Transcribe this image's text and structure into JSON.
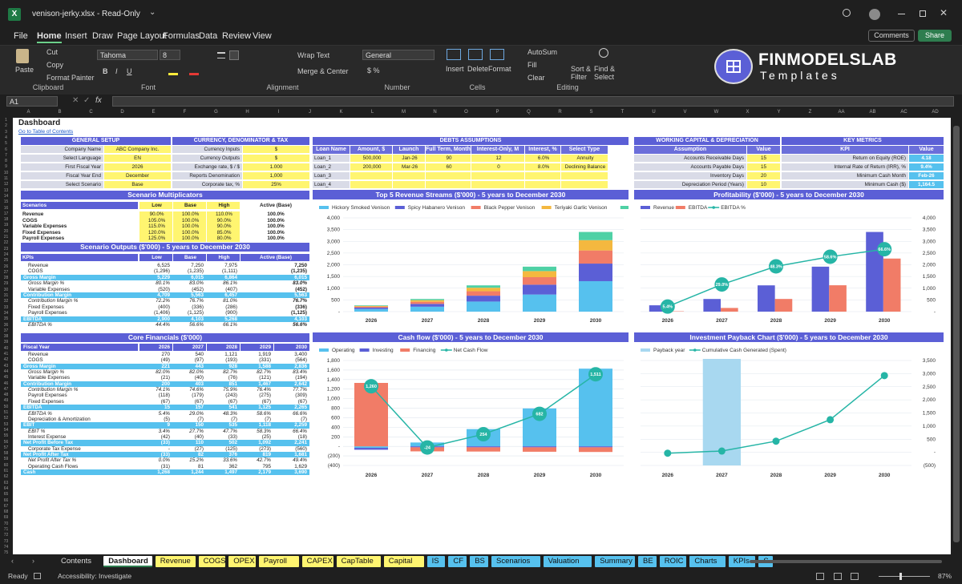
{
  "window": {
    "file_title": "venison-jerky.xlsx - Read-Only",
    "chevron": "⌄"
  },
  "menu": {
    "items": [
      "File",
      "Home",
      "Insert",
      "Draw",
      "Page Layout",
      "Formulas",
      "Data",
      "Review",
      "View"
    ],
    "active": "Home",
    "comments": "Comments",
    "share": "Share"
  },
  "ribbon": {
    "clipboard": {
      "paste": "Paste",
      "cut": "Cut",
      "copy": "Copy",
      "format_painter": "Format Painter",
      "group": "Clipboard"
    },
    "font": {
      "name": "Tahoma",
      "size": "8",
      "group": "Font"
    },
    "alignment": {
      "wrap": "Wrap Text",
      "merge": "Merge & Center",
      "group": "Alignment"
    },
    "number": {
      "format": "General",
      "group": "Number"
    },
    "cells": {
      "insert": "Insert",
      "delete": "Delete",
      "format": "Format",
      "group": "Cells"
    },
    "editing": {
      "autosum": "AutoSum",
      "fill": "Fill",
      "clear": "Clear",
      "sort": "Sort & Filter",
      "find": "Find & Select",
      "group": "Editing"
    },
    "logo": {
      "line1": "FINMODELSLAB",
      "line2": "Templates"
    }
  },
  "formula_bar": {
    "cell_ref": "A1",
    "fx": "fx",
    "value": ""
  },
  "columns": [
    "A",
    "B",
    "C",
    "D",
    "E",
    "F",
    "G",
    "H",
    "I",
    "J",
    "K",
    "L",
    "M",
    "N",
    "O",
    "P",
    "Q",
    "R",
    "S",
    "T",
    "U",
    "V",
    "W",
    "X",
    "Y",
    "Z",
    "AA",
    "AB",
    "AC",
    "AD"
  ],
  "rows": [
    "1",
    "2",
    "3",
    "4",
    "5",
    "6",
    "7",
    "8",
    "9",
    "10",
    "11",
    "12",
    "13",
    "14",
    "15",
    "16",
    "17",
    "18",
    "19",
    "20",
    "21",
    "22",
    "23",
    "24",
    "25",
    "26",
    "27",
    "28",
    "29",
    "30",
    "31",
    "32",
    "33",
    "34",
    "35",
    "36",
    "37",
    "38",
    "39",
    "40",
    "41",
    "42",
    "43",
    "44",
    "45",
    "46",
    "47",
    "48",
    "49",
    "50",
    "51",
    "52",
    "53",
    "54",
    "55",
    "56",
    "57",
    "58",
    "59",
    "60",
    "61",
    "62",
    "63",
    "64",
    "65",
    "66",
    "67",
    "68",
    "69",
    "70",
    "71",
    "72",
    "73",
    "74",
    "75"
  ],
  "sheet": {
    "title": "Dashboard",
    "toc_link": "Go to Table of Contents",
    "general_setup": {
      "header": "GENERAL SETUP",
      "rows": [
        [
          "Company Name",
          "ABC Company Inc."
        ],
        [
          "Select Language",
          "EN"
        ],
        [
          "First Fiscal Year",
          "2026"
        ],
        [
          "Fiscal Year End",
          "December"
        ],
        [
          "Select Scenario",
          "Base"
        ]
      ]
    },
    "currency": {
      "header": "CURRENCY, DENOMINATOR & TAX",
      "rows": [
        [
          "Currency Inputs",
          "$"
        ],
        [
          "Currency Outputs",
          "$"
        ],
        [
          "Exchange rate, $ / $",
          "1.000"
        ],
        [
          "Reports Denomination",
          "1,000"
        ],
        [
          "Corporate tax, %",
          "25%"
        ]
      ]
    },
    "debts": {
      "header": "DEBTS ASSUMPTIONS",
      "cols": [
        "Loan Name",
        "Amount, $",
        "Launch",
        "Full Term, Months",
        "Interest-Only, M",
        "Interest, %",
        "Select Type"
      ],
      "rows": [
        [
          "Loan_1",
          "500,000",
          "Jan-26",
          "90",
          "12",
          "6.0%",
          "Annuity"
        ],
        [
          "Loan_2",
          "200,000",
          "Mar-26",
          "60",
          "0",
          "8.0%",
          "Declining Balance"
        ],
        [
          "Loan_3",
          "",
          "",
          "",
          "",
          "",
          ""
        ],
        [
          "Loan_4",
          "",
          "",
          "",
          "",
          "",
          ""
        ]
      ]
    },
    "working_capital": {
      "header": "WORKING CAPITAL & DEPRECIATION",
      "cols": [
        "Assumption",
        "Value"
      ],
      "rows": [
        [
          "Accounts Receivable Days",
          "15"
        ],
        [
          "Accounts Payable Days",
          "15"
        ],
        [
          "Inventory Days",
          "20"
        ],
        [
          "Depreciation Period (Years)",
          "10"
        ]
      ]
    },
    "kpis": {
      "header": "KEY METRICS",
      "cols": [
        "KPI",
        "Value"
      ],
      "rows": [
        [
          "Return on Equity (ROE)",
          "4.18"
        ],
        [
          "Internal Rate of Return (IRR), %",
          "9.4%"
        ],
        [
          "Minimum Cash Month",
          "Feb-26"
        ],
        [
          "Minimum Cash ($)",
          "1,164.5"
        ]
      ]
    },
    "scenario_mult": {
      "header": "Scenario Multiplicators",
      "cols": [
        "Scenarios",
        "Low",
        "Base",
        "High",
        "Active (Base)"
      ],
      "rows": [
        [
          "Revenue",
          "90.0%",
          "100.0%",
          "110.0%",
          "100.0%"
        ],
        [
          "COGS",
          "105.0%",
          "100.0%",
          "90.0%",
          "100.0%"
        ],
        [
          "Variable Expenses",
          "115.0%",
          "100.0%",
          "90.0%",
          "100.0%"
        ],
        [
          "Fixed Expenses",
          "120.0%",
          "100.0%",
          "85.0%",
          "100.0%"
        ],
        [
          "Payroll Expenses",
          "125.0%",
          "100.0%",
          "80.0%",
          "100.0%"
        ]
      ]
    },
    "scenario_out": {
      "header": "Scenario Outputs ($'000) - 5 years to December 2030",
      "cols": [
        "KPIs",
        "Low",
        "Base",
        "High",
        "Active (Base)"
      ],
      "rows": [
        [
          "Revenue",
          "6,525",
          "7,250",
          "7,975",
          "7,250",
          "n"
        ],
        [
          "COGS",
          "(1,296)",
          "(1,235)",
          "(1,111)",
          "(1,235)",
          "n"
        ],
        [
          "Gross Margin",
          "5,229",
          "6,015",
          "6,864",
          "6,015",
          "h"
        ],
        [
          "Gross Margin %",
          "80.1%",
          "83.0%",
          "86.1%",
          "83.0%",
          "i"
        ],
        [
          "Variable Expenses",
          "(520)",
          "(452)",
          "(407)",
          "(452)",
          "n"
        ],
        [
          "Contribution Margin",
          "4,709",
          "5,563",
          "6,457",
          "5,563",
          "h"
        ],
        [
          "Contribution Margin %",
          "72.2%",
          "76.7%",
          "81.0%",
          "76.7%",
          "i"
        ],
        [
          "Fixed Expenses",
          "(400)",
          "(336)",
          "(286)",
          "(336)",
          "n"
        ],
        [
          "Payroll Expenses",
          "(1,406)",
          "(1,125)",
          "(900)",
          "(1,125)",
          "n"
        ],
        [
          "EBITDA",
          "2,900",
          "4,103",
          "5,268",
          "4,103",
          "h"
        ],
        [
          "EBITDA %",
          "44.4%",
          "56.6%",
          "66.1%",
          "56.6%",
          "i"
        ]
      ]
    },
    "core": {
      "header": "Core Financials ($'000)",
      "cols": [
        "Fiscal Year",
        "2026",
        "2027",
        "2028",
        "2029",
        "2030"
      ],
      "rows": [
        [
          "Revenue",
          "270",
          "540",
          "1,121",
          "1,919",
          "3,400",
          "n"
        ],
        [
          "COGS",
          "(49)",
          "(97)",
          "(193)",
          "(331)",
          "(564)",
          "n"
        ],
        [
          "Gross Margin",
          "221",
          "443",
          "928",
          "1,588",
          "2,836",
          "h"
        ],
        [
          "Gross Margin %",
          "82.0%",
          "82.0%",
          "82.7%",
          "82.7%",
          "83.4%",
          "i"
        ],
        [
          "Variable Expenses",
          "(21)",
          "(40)",
          "(76)",
          "(121)",
          "(194)",
          "n"
        ],
        [
          "Contribution Margin",
          "200",
          "403",
          "851",
          "1,467",
          "2,642",
          "h"
        ],
        [
          "Contribution Margin %",
          "74.1%",
          "74.6%",
          "75.9%",
          "76.4%",
          "77.7%",
          "i"
        ],
        [
          "Payroll Expenses",
          "(118)",
          "(179)",
          "(243)",
          "(275)",
          "(309)",
          "n"
        ],
        [
          "Fixed Expenses",
          "(67)",
          "(67)",
          "(67)",
          "(67)",
          "(67)",
          "n"
        ],
        [
          "EBITDA",
          "15",
          "157",
          "541",
          "1,125",
          "2,265",
          "h"
        ],
        [
          "EBITDA %",
          "5.4%",
          "29.0%",
          "48.3%",
          "58.6%",
          "66.6%",
          "i"
        ],
        [
          "Depreciation & Amortization",
          "(5)",
          "(7)",
          "(7)",
          "(7)",
          "(7)",
          "n"
        ],
        [
          "EBIT",
          "9",
          "150",
          "535",
          "1,118",
          "2,259",
          "h"
        ],
        [
          "EBIT %",
          "3.4%",
          "27.7%",
          "47.7%",
          "58.3%",
          "66.4%",
          "i"
        ],
        [
          "Interest Expense",
          "(42)",
          "(40)",
          "(33)",
          "(25)",
          "(18)",
          "n"
        ],
        [
          "Net Profit Before Tax",
          "(33)",
          "110",
          "502",
          "1,092",
          "2,241",
          "h"
        ],
        [
          "Corporate Tax Expense",
          "-",
          "(27)",
          "(125)",
          "(273)",
          "(560)",
          "n"
        ],
        [
          "Net Profit After Tax",
          "(33)",
          "82",
          "376",
          "819",
          "1,681",
          "h"
        ],
        [
          "Net Profit After Tax %",
          "0.0%",
          "15.2%",
          "33.6%",
          "42.7%",
          "49.4%",
          "i"
        ],
        [
          "Operating Cash Flows",
          "(31)",
          "81",
          "362",
          "795",
          "1,629",
          "n"
        ],
        [
          "Cash",
          "1,268",
          "1,244",
          "1,497",
          "2,179",
          "3,690",
          "h"
        ]
      ]
    }
  },
  "chart_data": [
    {
      "type": "bar",
      "title": "Top 5 Revenue Streams ($'000) - 5 years to December 2030",
      "categories": [
        "2026",
        "2027",
        "2028",
        "2029",
        "2030"
      ],
      "stacked": true,
      "ylim": [
        0,
        4000
      ],
      "yticks": [
        "4,000",
        "3,500",
        "3,000",
        "2,500",
        "2,000",
        "1,500",
        "1,000",
        "500",
        "-"
      ],
      "series": [
        {
          "name": "Hickory Smoked Venison",
          "color": "#56c1ee",
          "values": [
            110,
            210,
            430,
            730,
            1300
          ]
        },
        {
          "name": "Spicy Habanero Venison",
          "color": "#5b5fd6",
          "values": [
            60,
            120,
            250,
            420,
            750
          ]
        },
        {
          "name": "Black Pepper Venison",
          "color": "#f17c67",
          "values": [
            45,
            90,
            190,
            320,
            560
          ]
        },
        {
          "name": "Teriyaki Garlic Venison",
          "color": "#f4b83f",
          "values": [
            30,
            70,
            150,
            260,
            440
          ]
        },
        {
          "name": "Other Revenue",
          "color": "#4fd1a5",
          "values": [
            25,
            50,
            101,
            189,
            350
          ]
        }
      ]
    },
    {
      "type": "bar",
      "title": "Profitability ($'000) - 5 years to December 2030",
      "categories": [
        "2026",
        "2027",
        "2028",
        "2029",
        "2030"
      ],
      "ylim": [
        0,
        4000
      ],
      "yticks": [
        "4,000",
        "3,500",
        "3,000",
        "2,500",
        "2,000",
        "1,500",
        "1,000",
        "500",
        "-"
      ],
      "y2ticks": [
        "100.0%",
        "80.0%",
        "60.0%",
        "40.0%",
        "20.0%",
        "0.0%"
      ],
      "series": [
        {
          "name": "Revenue",
          "color": "#5b5fd6",
          "values": [
            270,
            540,
            1121,
            1919,
            3400
          ]
        },
        {
          "name": "EBITDA",
          "color": "#f17c67",
          "values": [
            15,
            157,
            541,
            1125,
            2265
          ]
        },
        {
          "name": "EBITDA %",
          "color": "#26b5a6",
          "line": true,
          "values": [
            5.4,
            29.0,
            48.3,
            58.6,
            66.6
          ],
          "labels": [
            "5.4%",
            "29.0%",
            "48.3%",
            "58.6%",
            "66.6%"
          ]
        }
      ]
    },
    {
      "type": "bar",
      "title": "Cash flow ($'000) - 5 years to December 2030",
      "categories": [
        "2026",
        "2027",
        "2028",
        "2029",
        "2030"
      ],
      "stacked": true,
      "ylim": [
        -400,
        1800
      ],
      "yticks": [
        "1,800",
        "1,600",
        "1,400",
        "1,200",
        "1,000",
        "800",
        "600",
        "400",
        "200",
        "-",
        "(200)",
        "(400)"
      ],
      "series": [
        {
          "name": "Operating",
          "color": "#56c1ee",
          "values": [
            -31,
            81,
            362,
            795,
            1629
          ]
        },
        {
          "name": "Investing",
          "color": "#5b5fd6",
          "values": [
            -40,
            -20,
            -20,
            -20,
            -20
          ]
        },
        {
          "name": "Financing",
          "color": "#f17c67",
          "values": [
            1330,
            -85,
            -89,
            -93,
            -98
          ]
        },
        {
          "name": "Net Cash Flow",
          "color": "#26b5a6",
          "line": true,
          "values": [
            1260,
            -24,
            254,
            682,
            1511
          ],
          "labels": [
            "1,260",
            "-24",
            "254",
            "682",
            "1,511"
          ]
        }
      ]
    },
    {
      "type": "line",
      "title": "Investment Payback Chart ($'000) - 5 years to December 2030",
      "categories": [
        "2026",
        "2027",
        "2028",
        "2029",
        "2030"
      ],
      "ylim": [
        -500,
        3500
      ],
      "yticks": [
        "3,500",
        "3,000",
        "2,500",
        "2,000",
        "1,500",
        "1,000",
        "500",
        "-",
        "(500)"
      ],
      "series": [
        {
          "name": "Payback year",
          "color": "#a8d8f0",
          "values": [
            0,
            1,
            0,
            0,
            0
          ]
        },
        {
          "name": "Cumulative Cash Generated (Spent)",
          "color": "#26b5a6",
          "line": true,
          "values": [
            -33,
            49,
            425,
            1244,
            2925
          ]
        }
      ]
    }
  ],
  "tabs": [
    {
      "label": "Contents",
      "color": ""
    },
    {
      "label": "Dashboard",
      "color": "white"
    },
    {
      "label": "Revenue",
      "color": "#fff570"
    },
    {
      "label": "COGS",
      "color": "#fff570"
    },
    {
      "label": "OPEX",
      "color": "#fff570"
    },
    {
      "label": "Payroll",
      "color": "#fff570"
    },
    {
      "label": "CAPEX",
      "color": "#fff570"
    },
    {
      "label": "CapTable",
      "color": "#fff570"
    },
    {
      "label": "Capital",
      "color": "#fff570"
    },
    {
      "label": "IS",
      "color": "#56c1ee"
    },
    {
      "label": "CF",
      "color": "#56c1ee"
    },
    {
      "label": "BS",
      "color": "#56c1ee"
    },
    {
      "label": "Scenarios",
      "color": "#56c1ee"
    },
    {
      "label": "Valuation",
      "color": "#56c1ee"
    },
    {
      "label": "Summary",
      "color": "#56c1ee"
    },
    {
      "label": "BE",
      "color": "#56c1ee"
    },
    {
      "label": "ROIC",
      "color": "#56c1ee"
    },
    {
      "label": "Charts",
      "color": "#56c1ee"
    },
    {
      "label": "KPIs",
      "color": "#56c1ee"
    },
    {
      "label": "S",
      "color": "#56c1ee"
    }
  ],
  "status": {
    "ready": "Ready",
    "accessibility": "Accessibility: Investigate",
    "zoom": "87%"
  },
  "colors": {
    "header_blue": "#5b5fd6",
    "highlight": "#56c1ee",
    "input_yellow": "#fff570",
    "grey": "#d9dbe7",
    "teal": "#26b5a6"
  }
}
